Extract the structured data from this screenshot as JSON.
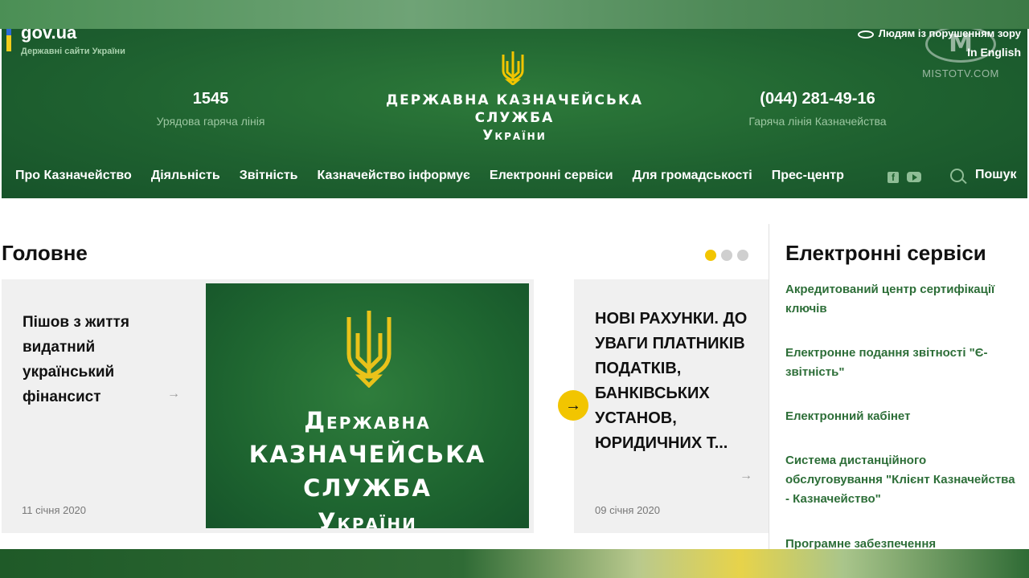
{
  "header": {
    "gov_title": "gov.ua",
    "gov_sub": "Державні сайти України",
    "hotline_left": {
      "number": "1545",
      "label": "Урядова гаряча лінія"
    },
    "brand_line1": "Державна казначейська служба",
    "brand_line2": "України",
    "hotline_right": {
      "number": "(044) 281-49-16",
      "label": "Гаряча лінія Казначейства"
    },
    "accessibility": "Людям із порушенням зору",
    "english": "In English",
    "watermark_text": "MISTOTV.COM",
    "watermark_logo": "M"
  },
  "nav": {
    "items": [
      {
        "label": "Про Казначейство"
      },
      {
        "label": "Діяльність"
      },
      {
        "label": "Звітність"
      },
      {
        "label": "Казначейство інформує"
      },
      {
        "label": "Електронні сервіси"
      },
      {
        "label": "Для громадськості"
      },
      {
        "label": "Прес-центр"
      }
    ],
    "search_label": "Пошук"
  },
  "main": {
    "title": "Головне",
    "card1": {
      "text": "Пішов з життя видатний український фінансист",
      "date": "11 січня 2020",
      "image_lines": [
        "Державна",
        "казначейська служба",
        "України"
      ]
    },
    "card2": {
      "text": "НОВІ РАХУНКИ. ДО УВАГИ ПЛАТНИКІВ ПОДАТКІВ, БАНКІВСЬКИХ УСТАНОВ, ЮРИДИЧНИХ Т...",
      "date": "09 січня 2020"
    }
  },
  "sidebar": {
    "title": "Електронні сервіси",
    "links": [
      "Акредитований центр сертифікації ключів",
      "Електронне подання звітності \"Є-звітність\"",
      "Електронний кабінет",
      "Система дистанційного обслуговування \"Клієнт Казначейства - Казначейство\"",
      "Програмне забезпечення"
    ]
  },
  "colors": {
    "header_green": "#1f6230",
    "accent_yellow": "#f2c500",
    "link_green": "#2d6e38"
  }
}
